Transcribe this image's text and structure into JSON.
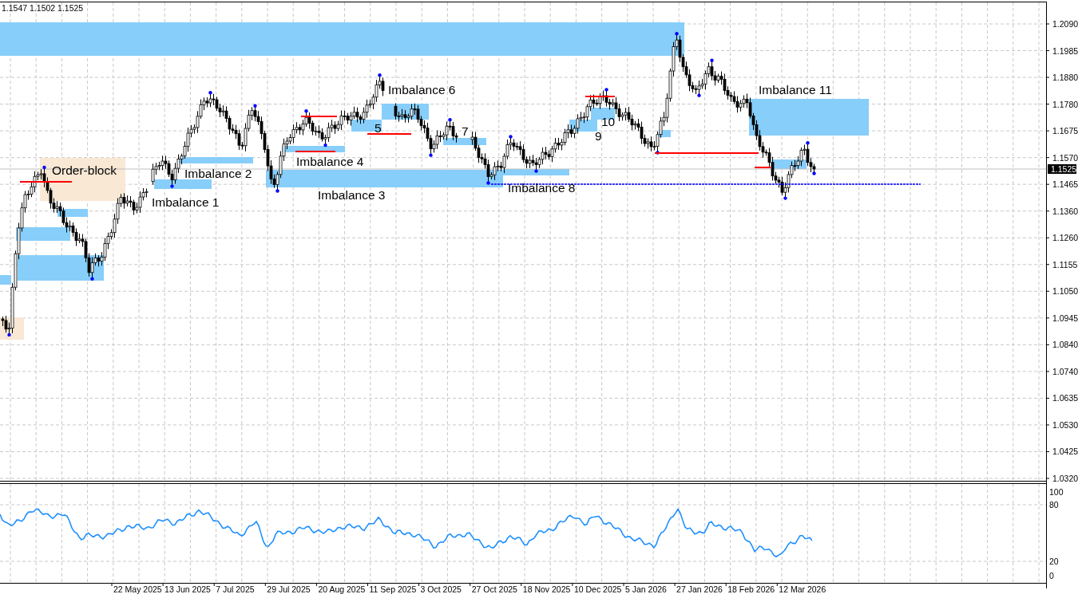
{
  "header": {
    "ohlc": "1.1547 1.1502 1.1525"
  },
  "price_axis": {
    "labels": [
      "1.2090",
      "1.1985",
      "1.1880",
      "1.1780",
      "1.1675",
      "1.1570",
      "1.1465",
      "1.1360",
      "1.1260",
      "1.1155",
      "1.1050",
      "1.0945",
      "1.0840",
      "1.0740",
      "1.0635",
      "1.0530",
      "1.0425",
      "1.0320"
    ],
    "current": "1.1525"
  },
  "zones": [
    {
      "kind": "imbalance"
    },
    {
      "kind": "order_block"
    },
    {
      "kind": "order_block"
    },
    {
      "kind": "imbalance"
    },
    {
      "kind": "imbalance"
    },
    {
      "kind": "imbalance"
    },
    {
      "kind": "imbalance"
    },
    {
      "kind": "imbalance"
    },
    {
      "kind": "imbalance"
    },
    {
      "kind": "imbalance"
    },
    {
      "kind": "imbalance"
    },
    {
      "kind": "imbalance"
    },
    {
      "kind": "imbalance"
    },
    {
      "kind": "imbalance"
    },
    {
      "kind": "imbalance"
    },
    {
      "kind": "imbalance"
    },
    {
      "kind": "imbalance"
    },
    {
      "kind": "imbalance"
    },
    {
      "kind": "imbalance"
    }
  ],
  "annotations": [
    {
      "text": "Order-block"
    },
    {
      "text": "Imbalance 1"
    },
    {
      "text": "Imbalance 2"
    },
    {
      "text": "Imbalance 4"
    },
    {
      "text": "Imbalance 3"
    },
    {
      "text": "Imbalance 6"
    },
    {
      "text": "5"
    },
    {
      "text": "7"
    },
    {
      "text": "Imbalance 8"
    },
    {
      "text": "9"
    },
    {
      "text": "10"
    },
    {
      "text": "Imbalance 11"
    }
  ],
  "oscillator_axis": {
    "labels": [
      "100",
      "80",
      "20",
      "0"
    ]
  },
  "time_axis": {
    "labels": [
      "22 May 2025",
      "13 Jun 2025",
      "7 Jul 2025",
      "29 Jul 2025",
      "20 Aug 2025",
      "11 Sep 2025",
      "3 Oct 2025",
      "27 Oct 2025",
      "18 Nov 2025",
      "10 Dec 2025",
      "5 Jan 2026",
      "27 Jan 2026",
      "18 Feb 2026",
      "12 Mar 2026"
    ]
  }
}
